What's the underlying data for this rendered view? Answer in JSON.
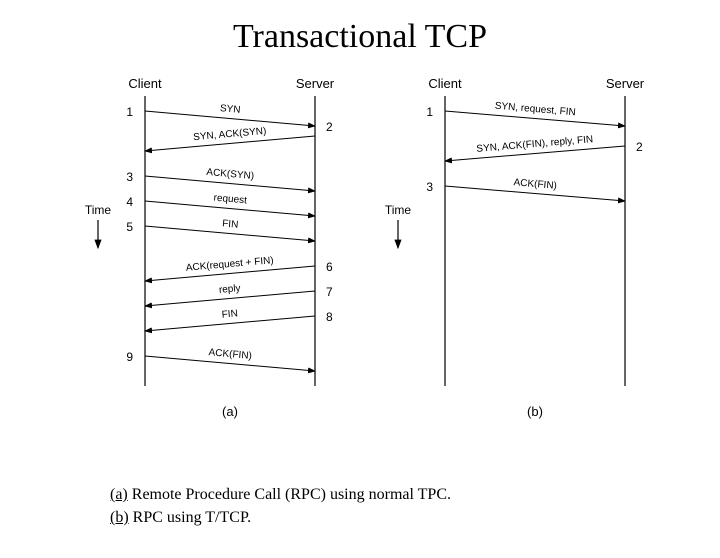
{
  "title": "Transactional TCP",
  "roles": {
    "client": "Client",
    "server": "Server",
    "time": "Time"
  },
  "sublabels": {
    "a": "(a)",
    "b": "(b)"
  },
  "caption": {
    "key_a": "(a)",
    "text_a": " Remote Procedure Call (RPC) using normal TPC.",
    "key_b": "(b)",
    "text_b": " RPC using T/TCP."
  },
  "diagram_a": {
    "client_ticks": [
      "1",
      "3",
      "4",
      "5",
      "9"
    ],
    "server_ticks": [
      "2",
      "6",
      "7",
      "8"
    ],
    "messages": [
      {
        "dir": "c2s",
        "label": "SYN"
      },
      {
        "dir": "s2c",
        "label": "SYN, ACK(SYN)"
      },
      {
        "dir": "c2s",
        "label": "ACK(SYN)"
      },
      {
        "dir": "c2s",
        "label": "request"
      },
      {
        "dir": "c2s",
        "label": "FIN"
      },
      {
        "dir": "s2c",
        "label": "ACK(request + FIN)"
      },
      {
        "dir": "s2c",
        "label": "reply"
      },
      {
        "dir": "s2c",
        "label": "FIN"
      },
      {
        "dir": "c2s",
        "label": "ACK(FIN)"
      }
    ]
  },
  "diagram_b": {
    "client_ticks": [
      "1",
      "3"
    ],
    "server_ticks": [
      "2"
    ],
    "messages": [
      {
        "dir": "c2s",
        "label": "SYN, request, FIN"
      },
      {
        "dir": "s2c",
        "label": "SYN, ACK(FIN), reply, FIN"
      },
      {
        "dir": "c2s",
        "label": "ACK(FIN)"
      }
    ]
  }
}
